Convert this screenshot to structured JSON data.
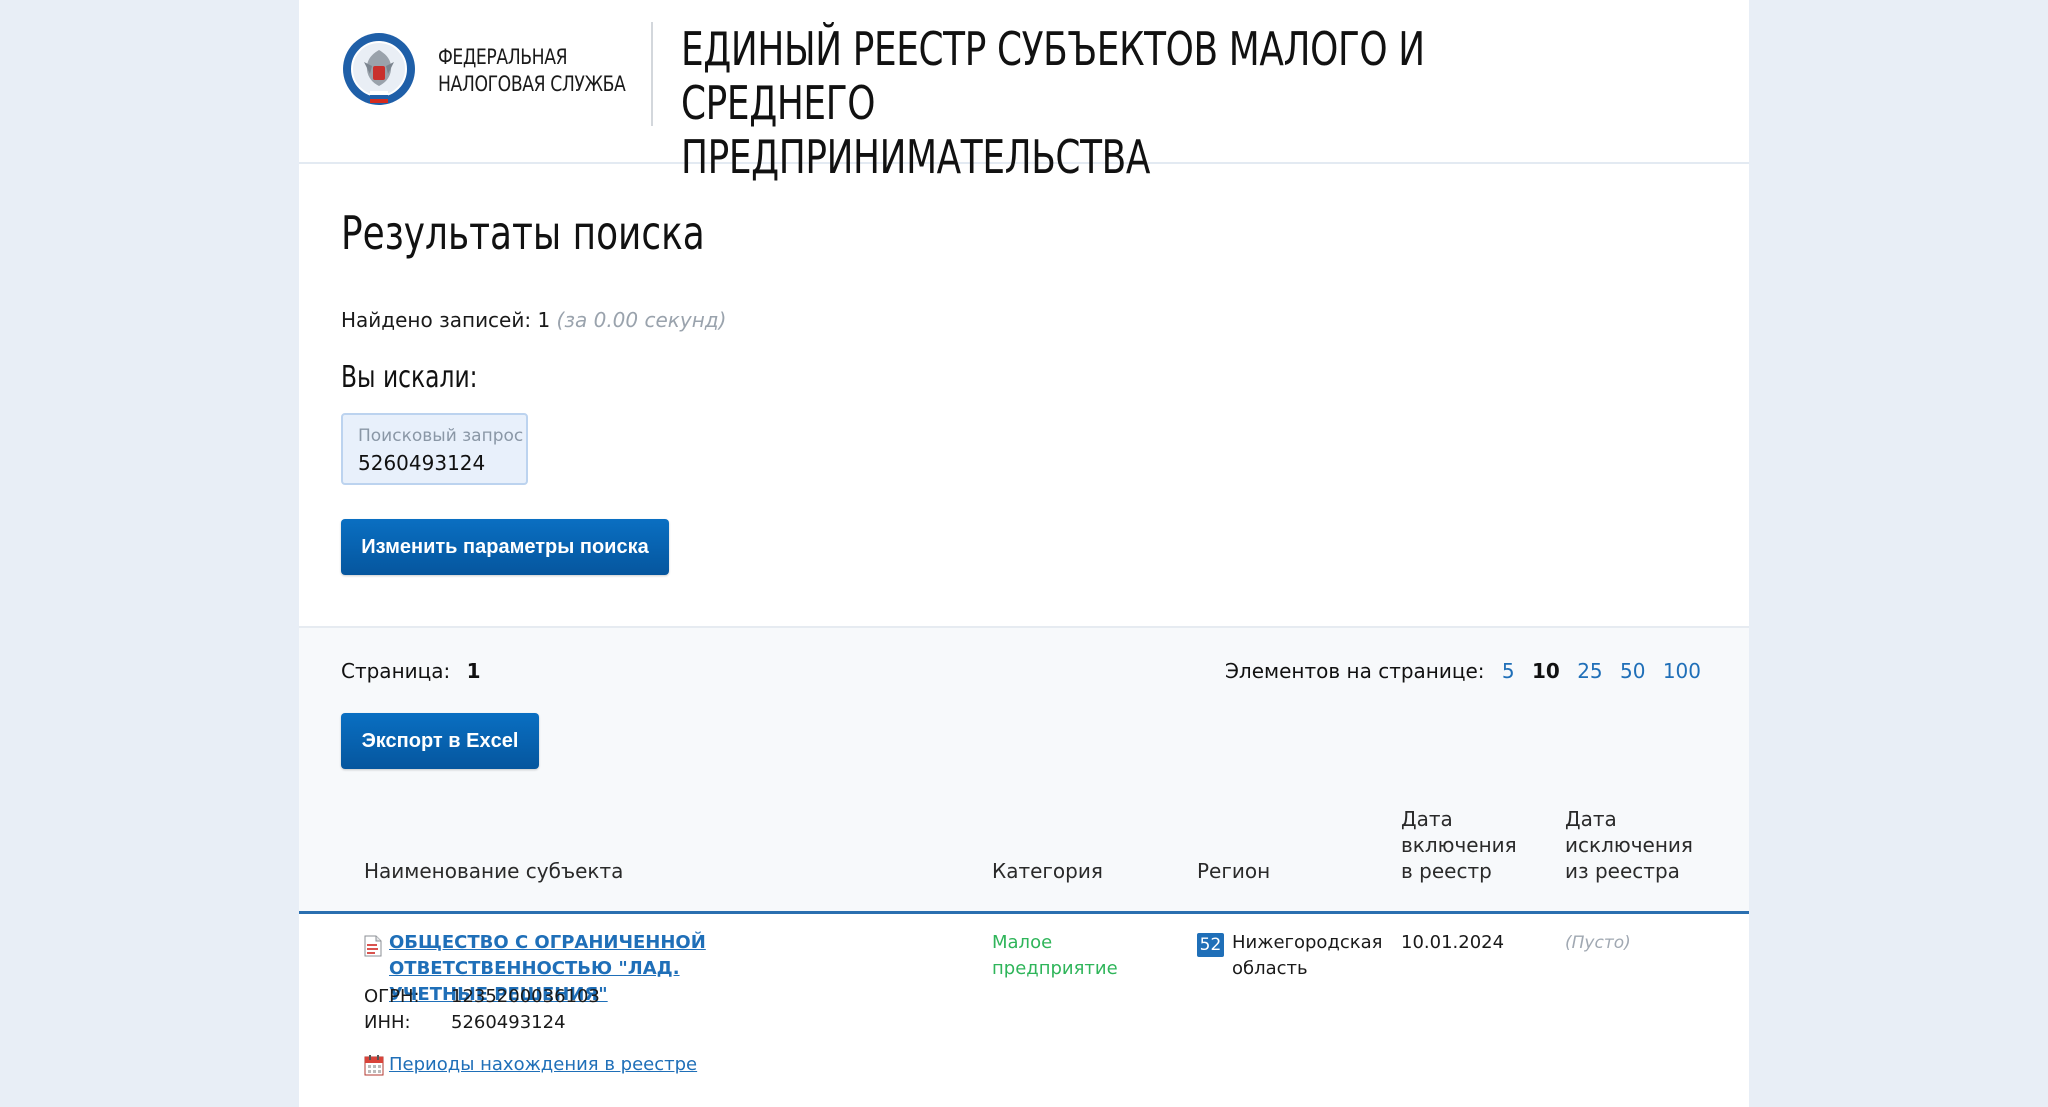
{
  "header": {
    "org_line1": "Федеральная",
    "org_line2": "налоговая служба",
    "title_line1": "Единый реестр субъектов малого и среднего",
    "title_line2": "предпринимательства"
  },
  "results": {
    "title": "Результаты поиска",
    "found_label": "Найдено записей: 1",
    "found_time": "(за 0.00 секунд)",
    "searched_label": "Вы искали:",
    "query_label": "Поисковый запрос",
    "query_value": "5260493124",
    "change_button": "Изменить параметры поиска"
  },
  "pagination": {
    "page_label": "Страница:",
    "page_number": "1",
    "per_page_label": "Элементов на странице:",
    "per_page_options": [
      "5",
      "10",
      "25",
      "50",
      "100"
    ],
    "per_page_active": "10"
  },
  "export_button": "Экспорт в Excel",
  "table": {
    "headers": {
      "name": "Наименование субъекта",
      "category": "Категория",
      "region": "Регион",
      "date_incl_1": "Дата",
      "date_incl_2": "включения",
      "date_incl_3": "в реестр",
      "date_excl_1": "Дата",
      "date_excl_2": "исключения",
      "date_excl_3": "из реестра"
    },
    "rows": [
      {
        "name_line1": "Общество с ограниченной ответственностью \"ЛАД.",
        "name_line2": "Учетные решения\"",
        "ogrn_label": "ОГРН:",
        "ogrn": "1235200036103",
        "inn_label": "ИНН:",
        "inn": "5260493124",
        "periods_link": "Периоды нахождения в реестре",
        "category_line1": "Малое",
        "category_line2": "предприятие",
        "region_code": "52",
        "region_line1": "Нижегородская",
        "region_line2": "область",
        "date_included": "10.01.2024",
        "date_excluded": "(Пусто)"
      }
    ]
  },
  "colors": {
    "accent": "#1f6fb8",
    "button": "#05569e",
    "category": "#2fb55a",
    "muted": "#9aa3ad"
  }
}
